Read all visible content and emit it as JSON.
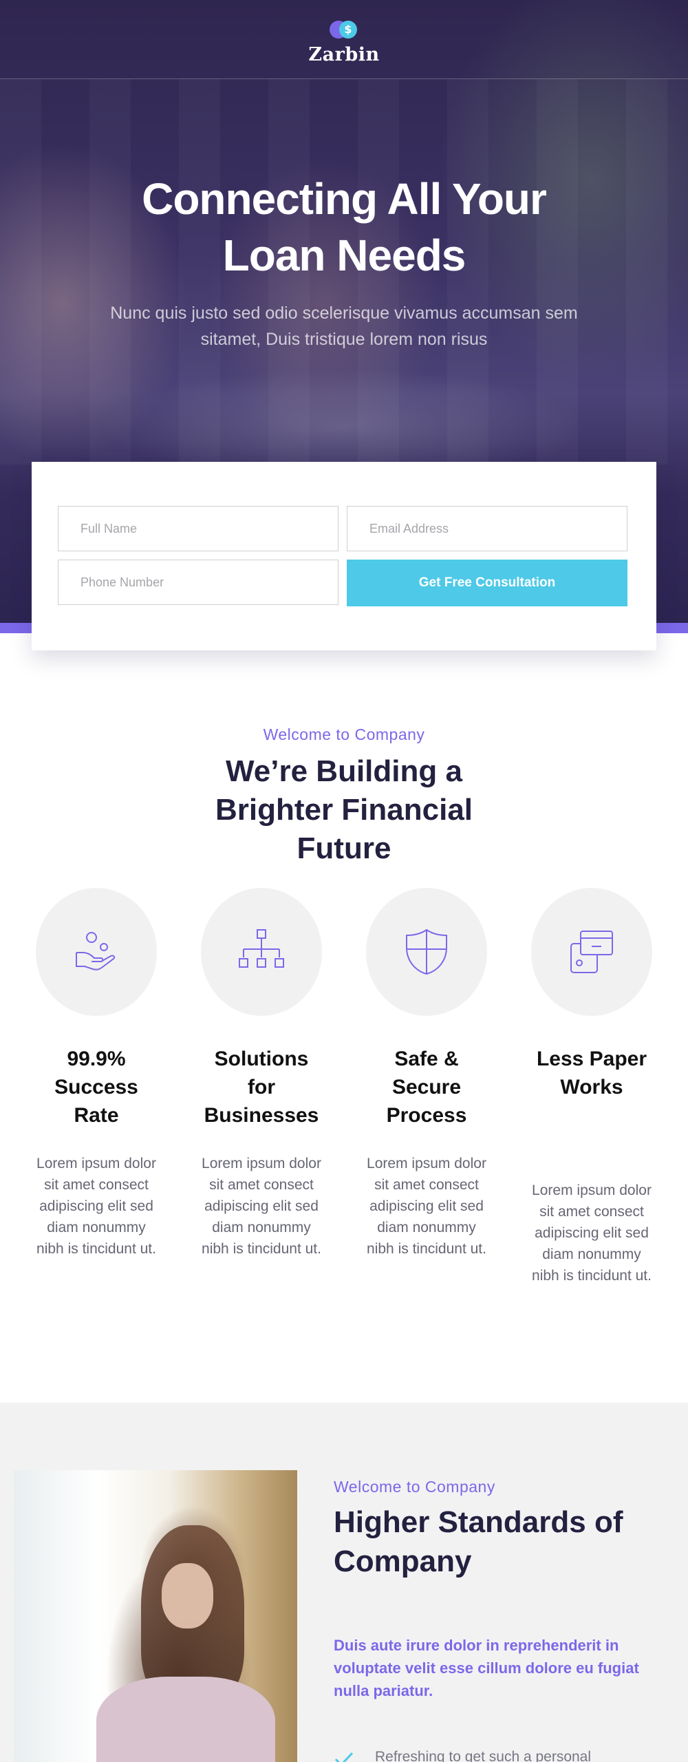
{
  "brand": {
    "name": "Zarbin",
    "logo_symbol": "$",
    "accent": "#7b68e8",
    "cta_color": "#4ec9e8",
    "logo_icon": "coin-logo-icon"
  },
  "hero": {
    "title": "Connecting All Your Loan Needs",
    "subtitle": "Nunc quis justo sed odio scelerisque vivamus accumsan sem sitamet, Duis tristique lorem non risus"
  },
  "form": {
    "name_placeholder": "Full Name",
    "email_placeholder": "Email Address",
    "phone_placeholder": "Phone Number",
    "submit_label": "Get Free Consultation"
  },
  "welcome": {
    "eyebrow": "Welcome to Company",
    "title": "We’re Building a Brighter Financial Future",
    "features": [
      {
        "icon": "hand-coins-icon",
        "title": "99.9% Success Rate",
        "desc": "Lorem ipsum dolor sit amet consect adipiscing elit sed diam nonummy nibh is tincidunt ut."
      },
      {
        "icon": "org-chart-icon",
        "title": "Solutions for Businesses",
        "desc": "Lorem ipsum dolor sit amet consect adipiscing elit sed diam nonummy nibh is tincidunt ut."
      },
      {
        "icon": "shield-icon",
        "title": "Safe & Secure Process",
        "desc": "Lorem ipsum dolor sit amet consect adipiscing elit sed diam nonummy nibh is tincidunt ut."
      },
      {
        "icon": "documents-icon",
        "title": "Less Paper Works",
        "desc": "Lorem ipsum dolor sit amet consect adipiscing elit sed diam nonummy nibh is tincidunt ut."
      }
    ]
  },
  "standards": {
    "eyebrow": "Welcome to Company",
    "title": "Higher Standards of Company",
    "lead": "Duis aute irure dolor in reprehenderit in voluptate velit esse cillum dolore eu fugiat nulla pariatur.",
    "checklist": [
      "Refreshing to get such a personal"
    ]
  }
}
